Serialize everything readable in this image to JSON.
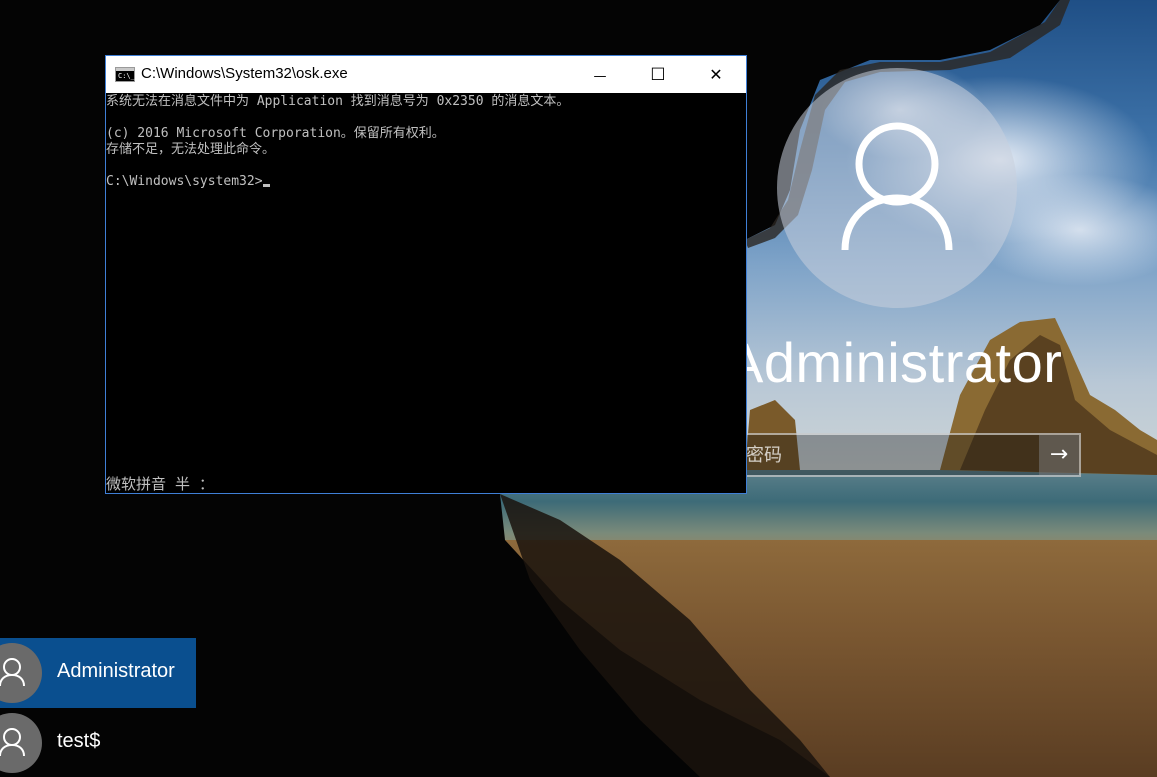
{
  "console_window": {
    "title": "C:\\Windows\\System32\\osk.exe",
    "icon": "cmd-console-icon",
    "controls": {
      "minimize": "—",
      "maximize": "☐",
      "close": "✕"
    },
    "lines": [
      "系统无法在消息文件中为 Application 找到消息号为 0x2350 的消息文本。",
      "(c) 2016 Microsoft Corporation。保留所有权利。",
      "存储不足，无法处理此命令。",
      "C:\\Windows\\system32>"
    ],
    "ime_status": "微软拼音 半 ："
  },
  "login": {
    "username": "Administrator",
    "password_placeholder": "密码",
    "submit_icon": "arrow-right-icon",
    "submit_glyph": "→"
  },
  "user_list": [
    {
      "name": "Administrator",
      "selected": true
    },
    {
      "name": "test$",
      "selected": false
    }
  ],
  "colors": {
    "selected_user_bg": "#0a4f8f",
    "console_border": "#3f7fd6",
    "console_text": "#c0c0c0"
  }
}
